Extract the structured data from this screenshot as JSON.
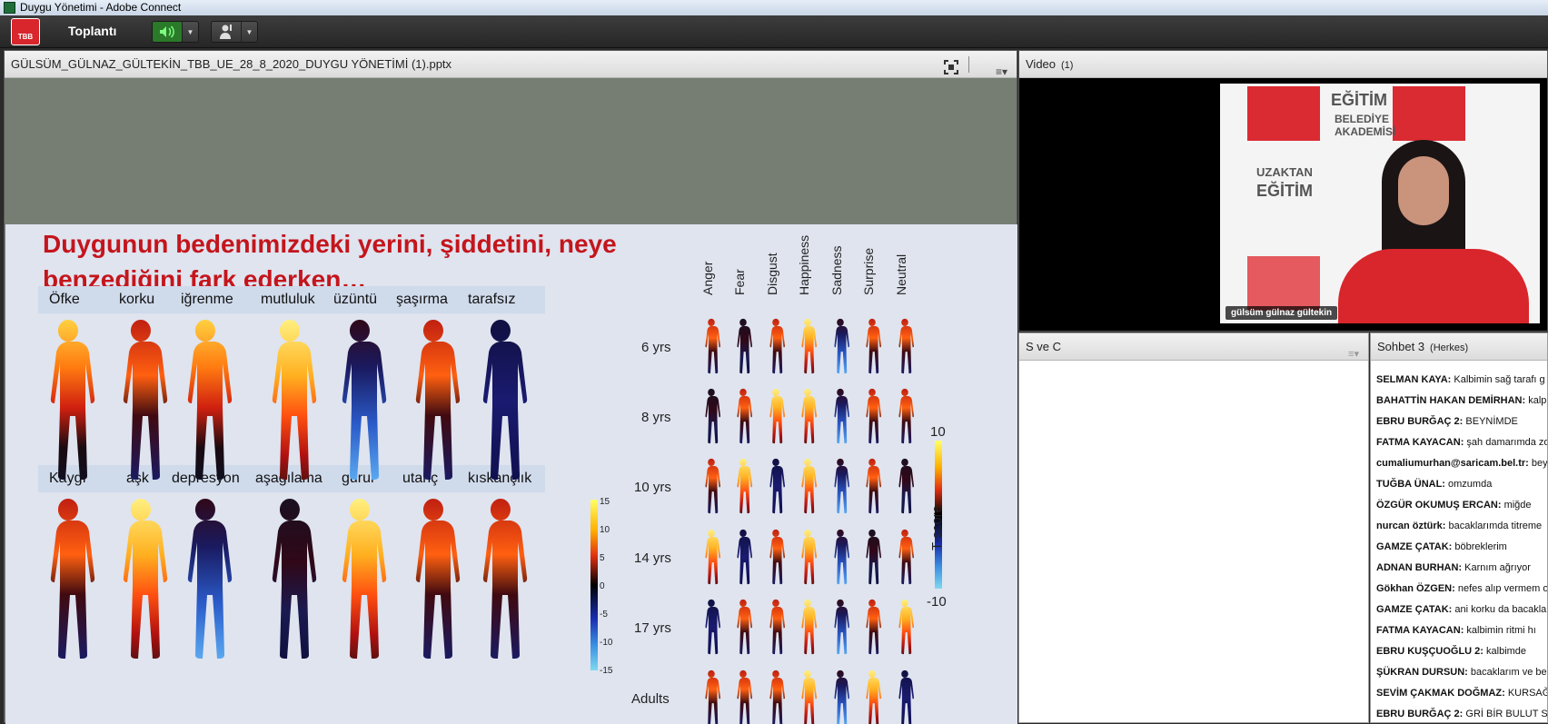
{
  "window": {
    "title": "Duygu Yönetimi - Adobe Connect"
  },
  "menubar": {
    "logo_text": "TBB",
    "menu_label": "Toplantı"
  },
  "share_pod": {
    "file_name": "GÜLSÜM_GÜLNAZ_GÜLTEKİN_TBB_UE_28_8_2020_DUYGU YÖNETİMİ (1).pptx"
  },
  "slide": {
    "title_line1": "Duygunun bedenimizdeki yerini, şiddetini, neye",
    "title_line2": "benzediğini fark ederken…",
    "row1_labels": [
      "Öfke",
      "korku",
      "iğrenme",
      "mutluluk",
      "üzüntü",
      "şaşırma",
      "tarafsız"
    ],
    "row2_labels": [
      "Kaygı",
      "aşk",
      "depresyon",
      "aşağılama",
      "gurur",
      "utanç",
      "kıskançlık"
    ],
    "colorbar_ticks": [
      "15",
      "10",
      "5",
      "0",
      "-5",
      "-10",
      "-15"
    ],
    "emotions_en": [
      "Anger",
      "Fear",
      "Disgust",
      "Happiness",
      "Sadness",
      "Surprise",
      "Neutral"
    ],
    "ages": [
      "6 yrs",
      "8 yrs",
      "10 yrs",
      "14 yrs",
      "17 yrs",
      "Adults"
    ],
    "tscore_max": "10",
    "tscore_min": "-10",
    "tscore_label": "T-score"
  },
  "video_pod": {
    "title": "Video",
    "count": "(1)",
    "participant_name": "gülsüm gülnaz gültekin",
    "backdrop": {
      "word1": "EĞİTİM",
      "word2": "BELEDİYE",
      "word3": "AKADEMİSİ",
      "word4": "UZAKTAN"
    }
  },
  "qa_pod": {
    "title": "S ve C"
  },
  "chat_pod": {
    "title": "Sohbet 3",
    "audience": "(Herkes)",
    "messages": [
      {
        "who": "SELMAN KAYA:",
        "text": "Kalbimin sağ tarafı g"
      },
      {
        "who": "BAHATTİN HAKAN DEMİRHAN:",
        "text": "kalp"
      },
      {
        "who": "EBRU BURĞAÇ 2:",
        "text": "BEYNİMDE"
      },
      {
        "who": "FATMA KAYACAN:",
        "text": "şah damarımda zon"
      },
      {
        "who": "cumaliumurhan@saricam.bel.tr:",
        "text": "beyni"
      },
      {
        "who": "TUĞBA ÜNAL:",
        "text": "omzumda"
      },
      {
        "who": "ÖZGÜR OKUMUŞ ERCAN:",
        "text": "miğde"
      },
      {
        "who": "nurcan öztürk:",
        "text": "bacaklarımda titreme"
      },
      {
        "who": "GAMZE ÇATAK:",
        "text": "böbreklerim"
      },
      {
        "who": "ADNAN BURHAN:",
        "text": "Karnım ağrıyor"
      },
      {
        "who": "Gökhan ÖZGEN:",
        "text": "nefes alıp vermem o"
      },
      {
        "who": "GAMZE ÇATAK:",
        "text": "ani korku da bacakla"
      },
      {
        "who": "FATMA KAYACAN:",
        "text": "kalbimin ritmi hı"
      },
      {
        "who": "EBRU KUŞÇUOĞLU 2:",
        "text": "kalbimde"
      },
      {
        "who": "ŞÜKRAN DURSUN:",
        "text": "bacaklarım ve be"
      },
      {
        "who": "SEVİM ÇAKMAK DOĞMAZ:",
        "text": "KURSAĞ"
      },
      {
        "who": "EBRU BURĞAÇ 2:",
        "text": "GRİ BİR BULUT SA"
      }
    ]
  },
  "colors": {
    "accent_red": "#c4151c",
    "speaker_green": "#2a7a2a"
  }
}
